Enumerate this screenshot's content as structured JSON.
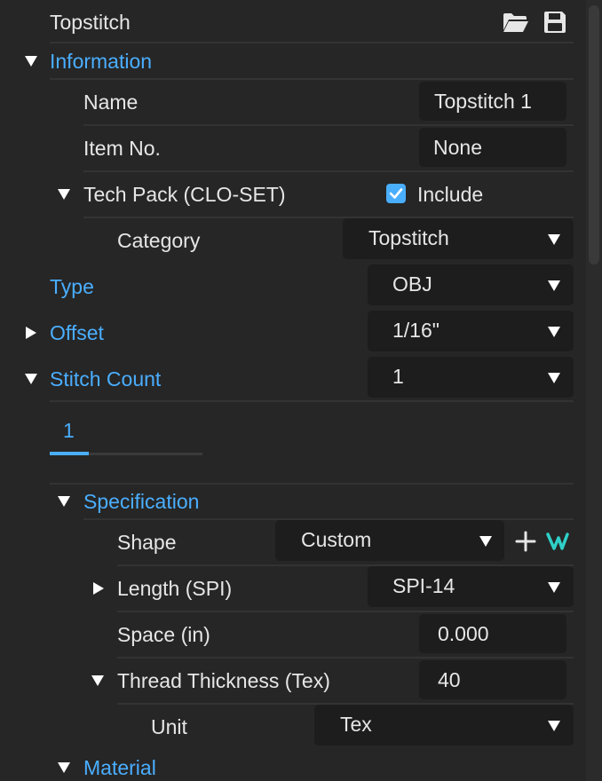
{
  "header": {
    "title": "Topstitch",
    "open_icon": "folder-open-icon",
    "save_icon": "save-disk-icon"
  },
  "information": {
    "label": "Information",
    "name": {
      "label": "Name",
      "value": "Topstitch 1"
    },
    "item_no": {
      "label": "Item No.",
      "value": "None"
    },
    "tech_pack": {
      "label": "Tech Pack (CLO-SET)",
      "include_label": "Include",
      "include_checked": true,
      "category": {
        "label": "Category",
        "value": "Topstitch"
      }
    }
  },
  "type": {
    "label": "Type",
    "value": "OBJ"
  },
  "offset": {
    "label": "Offset",
    "value": "1/16\""
  },
  "stitch_count": {
    "label": "Stitch Count",
    "value": "1",
    "tabs": [
      "1"
    ]
  },
  "specification": {
    "label": "Specification",
    "shape": {
      "label": "Shape",
      "value": "Custom",
      "add_icon": "plus-icon",
      "curve_icon": "stitch-shape-icon"
    },
    "length": {
      "label": "Length (SPI)",
      "value": "SPI-14"
    },
    "space": {
      "label": "Space (in)",
      "value": "0.000"
    },
    "thread": {
      "label": "Thread Thickness (Tex)",
      "value": "40"
    },
    "unit": {
      "label": "Unit",
      "value": "Tex"
    }
  },
  "material": {
    "label": "Material"
  },
  "colors": {
    "accent": "#4aaeff",
    "background": "#262626",
    "field": "#1d1d1d",
    "curve_icon": "#2fd0c8"
  }
}
